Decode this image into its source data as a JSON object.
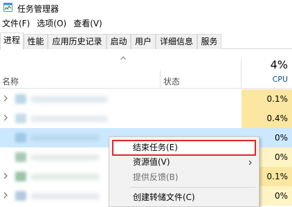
{
  "window": {
    "title": "任务管理器"
  },
  "menu": [
    "文件(F)",
    "选项(O)",
    "查看(V)"
  ],
  "tabs": [
    "进程",
    "性能",
    "应用历史记录",
    "启动",
    "用户",
    "详细信息",
    "服务"
  ],
  "columns": {
    "name": "名称",
    "status": "状态",
    "cpu_total": "4%",
    "cpu_label": "CPU"
  },
  "rows": [
    {
      "cpu": "0.1%",
      "expandable": true
    },
    {
      "cpu": "0.4%",
      "expandable": true
    },
    {
      "cpu": "0%",
      "expandable": false,
      "selected": true
    },
    {
      "cpu": "0%",
      "expandable": false
    },
    {
      "cpu": "0.1%",
      "expandable": true
    },
    {
      "cpu": "0%",
      "expandable": true
    }
  ],
  "context_menu": {
    "end_task": "结束任务(E)",
    "resource_values": "资源值(V)",
    "provide_feedback": "提供反馈(B)",
    "create_dump": "创建转储文件(C)"
  },
  "colors": {
    "selection": "#cce8ff",
    "cpu_heat_low": "#fff4c4",
    "cpu_heat_mid": "#fbe7a1",
    "highlight_border": "#e0242b"
  }
}
